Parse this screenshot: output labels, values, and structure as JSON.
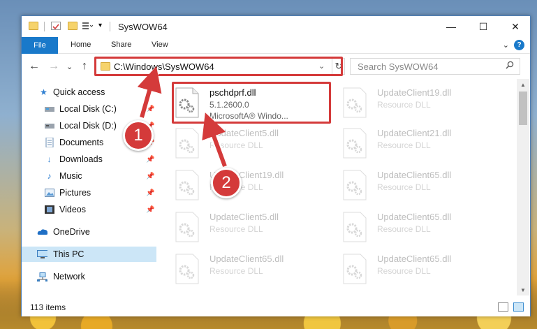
{
  "window": {
    "title": "SysWOW64",
    "minimize": "—",
    "maximize": "☐",
    "close": "✕"
  },
  "ribbon": {
    "file_tab": "File",
    "tabs": [
      "Home",
      "Share",
      "View"
    ],
    "help": "?",
    "collapse": "⌄"
  },
  "address": {
    "path": "C:\\Windows\\SysWOW64",
    "dropdown": "⌄",
    "refresh": "↻",
    "back": "←",
    "forward": "→",
    "recent": "⌄",
    "up": "↑"
  },
  "search": {
    "placeholder": "Search SysWOW64",
    "icon": "search-icon"
  },
  "sidebar": {
    "items": [
      {
        "label": "Quick access",
        "icon": "star-icon"
      },
      {
        "label": "Local Disk (C:)",
        "icon": "drive-icon"
      },
      {
        "label": "Local Disk (D:)",
        "icon": "drive-icon"
      },
      {
        "label": "Documents",
        "icon": "documents-icon"
      },
      {
        "label": "Downloads",
        "icon": "download-icon"
      },
      {
        "label": "Music",
        "icon": "music-icon"
      },
      {
        "label": "Pictures",
        "icon": "pictures-icon"
      },
      {
        "label": "Videos",
        "icon": "videos-icon"
      },
      {
        "label": "OneDrive",
        "icon": "cloud-icon"
      },
      {
        "label": "This PC",
        "icon": "computer-icon"
      },
      {
        "label": "Network",
        "icon": "network-icon"
      }
    ]
  },
  "files": [
    {
      "name": "pschdprf.dll",
      "line2": "5.1.2600.0",
      "line3": "MicrosoftA® Windo..."
    },
    {
      "name": "UpdateClient19.dll",
      "line2": "Resource DLL"
    },
    {
      "name": "UpdateClient5.dll",
      "line2": "Resource DLL"
    },
    {
      "name": "UpdateClient21.dll",
      "line2": "Resource DLL"
    },
    {
      "name": "UpdateClient19.dll",
      "line2": "Resource DLL"
    },
    {
      "name": "UpdateClient65.dll",
      "line2": "Resource DLL"
    },
    {
      "name": "UpdateClient5.dll",
      "line2": "Resource DLL"
    },
    {
      "name": "UpdateClient65.dll",
      "line2": "Resource DLL"
    },
    {
      "name": "UpdateClient65.dll",
      "line2": "Resource DLL"
    },
    {
      "name": "UpdateClient65.dll",
      "line2": "Resource DLL"
    }
  ],
  "status": {
    "count": "113 items"
  },
  "callouts": [
    "1",
    "2"
  ],
  "colors": {
    "accent": "#1979ca",
    "highlight": "#d43a3a",
    "selected": "#cce6f7"
  }
}
